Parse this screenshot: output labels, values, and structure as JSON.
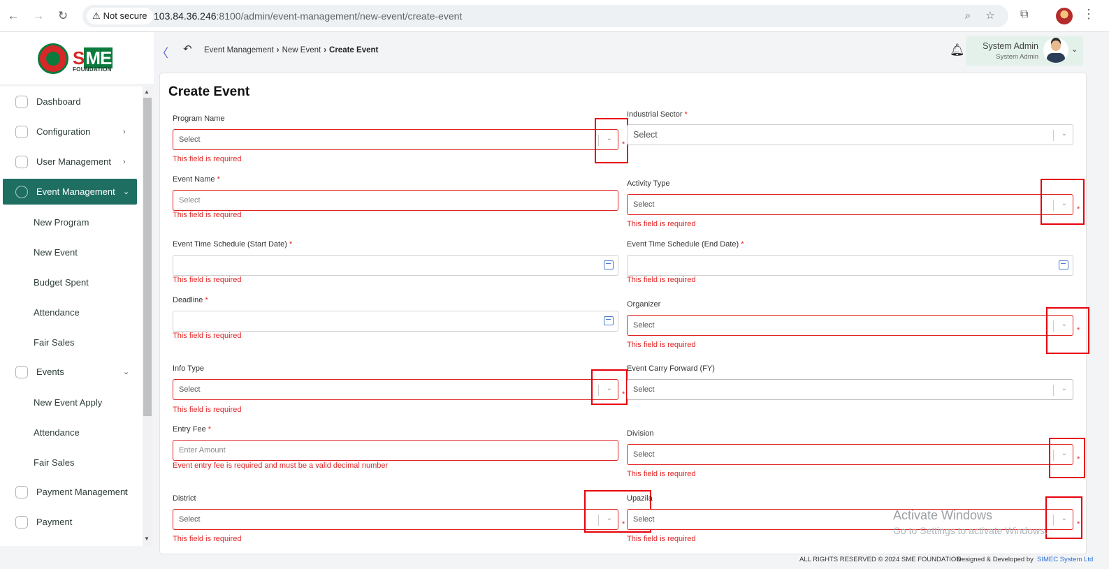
{
  "browser": {
    "security_label": "Not secure",
    "url_host": "103.84.36.246",
    "url_path": ":8100/admin/event-management/new-event/create-event"
  },
  "brand": {
    "logo_text_sme": "SME",
    "logo_subtext": "FOUNDATION",
    "colors": {
      "primary": "#1f6e62",
      "error": "#e02424",
      "brand_red": "#d62828",
      "brand_green": "#0a7a3d"
    }
  },
  "sidebar": {
    "items": [
      {
        "label": "Dashboard",
        "icon": "dashboard-icon"
      },
      {
        "label": "Configuration",
        "icon": "configuration-icon"
      },
      {
        "label": "User Management",
        "icon": "user-management-icon"
      },
      {
        "label": "Event Management",
        "icon": "event-management-icon"
      },
      {
        "label": "Events",
        "icon": "events-icon"
      },
      {
        "label": "Payment Management",
        "icon": "payment-management-icon"
      },
      {
        "label": "Payment",
        "icon": "payment-icon"
      }
    ],
    "event_management_sub": [
      "New Program",
      "New Event",
      "Budget Spent",
      "Attendance",
      "Fair Sales"
    ],
    "events_sub": [
      "New Event Apply",
      "Attendance",
      "Fair Sales"
    ]
  },
  "header": {
    "breadcrumb": [
      "Event Management",
      "New Event",
      "Create Event"
    ],
    "user_name": "System Admin",
    "user_role": "System Admin"
  },
  "form": {
    "title": "Create Event",
    "required_mark": "*",
    "error_required": "This field is required",
    "error_entry_fee": "Event entry fee is required and must be a valid decimal number",
    "select_placeholder": "Select",
    "fields": {
      "program_name": {
        "label": "Program Name",
        "value": "Select"
      },
      "industrial_sector": {
        "label": "Industrial Sector",
        "value": "Select"
      },
      "event_name": {
        "label": "Event Name",
        "placeholder": "Select"
      },
      "activity_type": {
        "label": "Activity Type",
        "value": "Select"
      },
      "start_date": {
        "label": "Event Time Schedule (Start Date)",
        "value": ""
      },
      "end_date": {
        "label": "Event Time Schedule (End Date)",
        "value": ""
      },
      "deadline": {
        "label": "Deadline",
        "value": ""
      },
      "organizer": {
        "label": "Organizer",
        "value": "Select"
      },
      "info_type": {
        "label": "Info Type",
        "value": "Select"
      },
      "carry_forward": {
        "label": "Event Carry Forward (FY)",
        "value": "Select"
      },
      "entry_fee": {
        "label": "Entry Fee",
        "placeholder": "Enter Amount"
      },
      "division": {
        "label": "Division",
        "value": "Select"
      },
      "district": {
        "label": "District",
        "value": "Select"
      },
      "upazila": {
        "label": "Upazila",
        "value": "Select"
      }
    }
  },
  "watermark": {
    "line1": "Activate Windows",
    "line2": "Go to Settings to activate Windows."
  },
  "footer": {
    "rights": "ALL RIGHTS RESERVED © 2024 SME FOUNDATION",
    "designed": "Designed & Developed by",
    "company": "SIMEC System Ltd"
  }
}
